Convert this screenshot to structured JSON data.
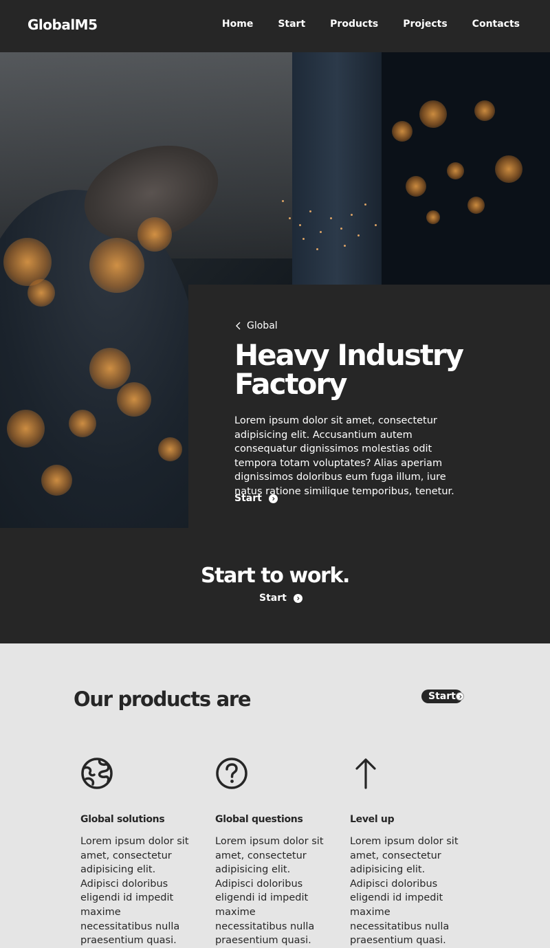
{
  "header": {
    "logo": "GlobalM5",
    "nav": [
      "Home",
      "Start",
      "Products",
      "Projects",
      "Contacts"
    ]
  },
  "hero": {
    "breadcrumb": "Global",
    "title": "Heavy Industry Factory",
    "description": "Lorem ipsum dolor sit amet, consectetur adipisicing elit. Accusantium autem consequatur dignissimos molestias odit tempora totam voluptates? Alias aperiam dignissimos doloribus eum fuga illum, iure natus ratione similique temporibus, tenetur.",
    "cta": "Start"
  },
  "band": {
    "title": "Start to work.",
    "cta": "Start"
  },
  "products": {
    "title": "Our products are",
    "cta": "Start",
    "features": [
      {
        "icon": "globe-icon",
        "title": "Global solutions",
        "text": "Lorem ipsum dolor sit amet, consectetur adipisicing elit. Adipisci doloribus eligendi id impedit maxime necessitatibus nulla praesentium quasi."
      },
      {
        "icon": "question-circle-icon",
        "title": "Global questions",
        "text": "Lorem ipsum dolor sit amet, consectetur adipisicing elit. Adipisci doloribus eligendi id impedit maxime necessitatibus nulla praesentium quasi."
      },
      {
        "icon": "arrow-up-icon",
        "title": "Level up",
        "text": "Lorem ipsum dolor sit amet, consectetur adipisicing elit. Adipisci doloribus eligendi id impedit maxime necessitatibus nulla praesentium quasi."
      }
    ]
  },
  "colors": {
    "dark": "#262626",
    "light": "#e5e5e5",
    "accent": "#ec9f46"
  }
}
